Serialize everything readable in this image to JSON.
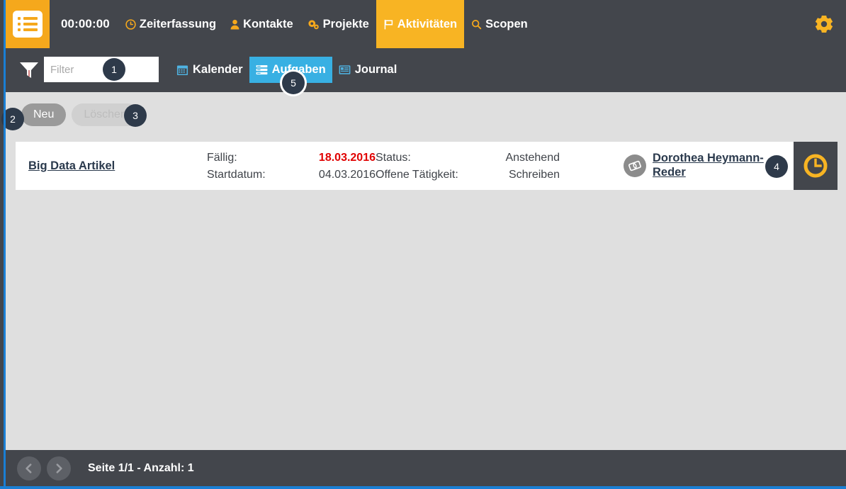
{
  "app": {
    "logo_icon": "list-logo-icon",
    "accent_orange": "#f5a81c",
    "accent_blue": "#38b0e3",
    "rail_blue": "#1a7fd4",
    "dark_bg": "#43464c",
    "content_bg": "#dfdfdf"
  },
  "topnav": {
    "timer": "00:00:00",
    "items": [
      {
        "label": "Zeiterfassung",
        "icon": "clock-icon",
        "active": false
      },
      {
        "label": "Kontakte",
        "icon": "person-icon",
        "active": false
      },
      {
        "label": "Projekte",
        "icon": "gears-icon",
        "active": false
      },
      {
        "label": "Aktivitäten",
        "icon": "flag-icon",
        "active": true
      },
      {
        "label": "Scopen",
        "icon": "magnifier-icon",
        "active": false
      }
    ],
    "settings_icon": "gear-icon"
  },
  "subbar": {
    "filter_icon": "funnel-icon",
    "filter_placeholder": "Filter",
    "filter_value": "",
    "view_tabs": [
      {
        "label": "Kalender",
        "icon": "calendar-icon",
        "active": false
      },
      {
        "label": "Aufgaben",
        "icon": "tasks-icon",
        "active": true
      },
      {
        "label": "Journal",
        "icon": "journal-icon",
        "active": false
      }
    ]
  },
  "toolbar": {
    "new_label": "Neu",
    "delete_label": "Löschen"
  },
  "task_row": {
    "title": "Big Data Artikel",
    "due_label": "Fällig:",
    "due_value": "18.03.2016",
    "start_label": "Startdatum:",
    "start_value": "04.03.2016",
    "status_label": "Status:",
    "status_value": "Anstehend",
    "open_activity_label": "Offene Tätigkeit:",
    "open_activity_value": "Schreiben",
    "assignee_name": "Dorothea Heymann-Reder",
    "assignee_avatar_icon": "card-icon",
    "action_icon": "clock-icon"
  },
  "footer": {
    "prev_icon": "chevron-left-icon",
    "next_icon": "chevron-right-icon",
    "page_info": "Seite 1/1 - Anzahl: 1"
  },
  "badges": [
    {
      "id": "1",
      "label": "1"
    },
    {
      "id": "2",
      "label": "2"
    },
    {
      "id": "3",
      "label": "3"
    },
    {
      "id": "4",
      "label": "4"
    },
    {
      "id": "5",
      "label": "5"
    }
  ]
}
